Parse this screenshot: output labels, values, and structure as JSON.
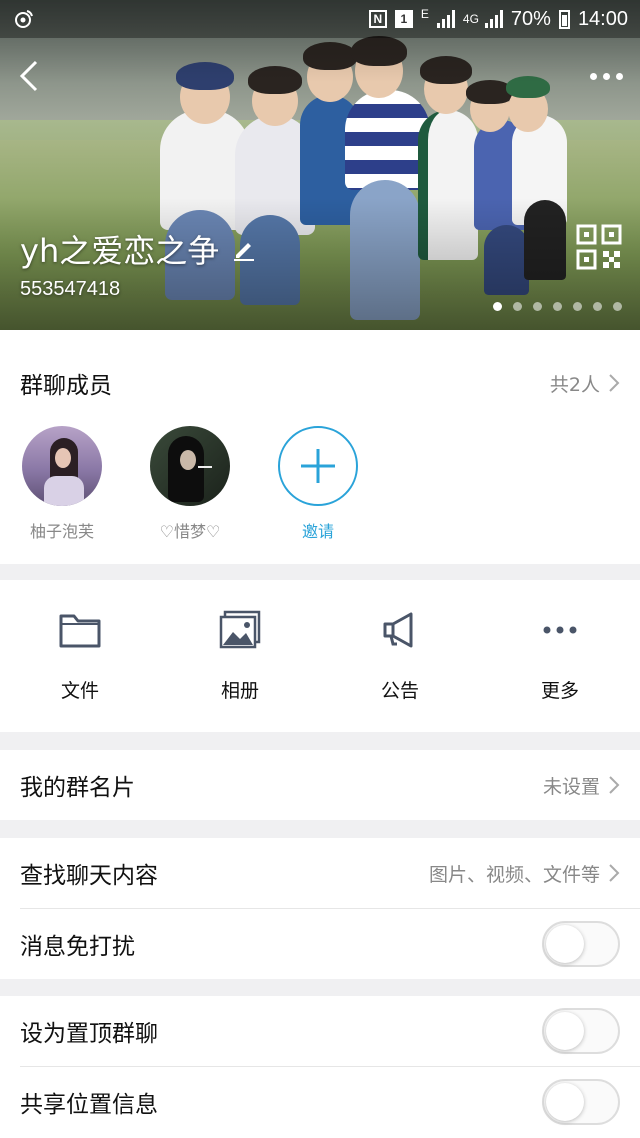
{
  "status_bar": {
    "time": "14:00",
    "battery": "70%",
    "network": "4G",
    "e_label": "E",
    "sim": "1",
    "nfc": "N"
  },
  "header": {
    "group_name": "yh之爱恋之争",
    "group_id": "553547418",
    "carousel_pages": 7,
    "carousel_active": 0
  },
  "members": {
    "title": "群聊成员",
    "count_text": "共2人",
    "list": [
      {
        "name": "柚子泡芙"
      },
      {
        "name": "♡惜梦♡"
      }
    ],
    "invite_label": "邀请"
  },
  "tools": [
    {
      "label": "文件",
      "icon": "folder-icon"
    },
    {
      "label": "相册",
      "icon": "album-icon"
    },
    {
      "label": "公告",
      "icon": "megaphone-icon"
    },
    {
      "label": "更多",
      "icon": "more-dots-icon"
    }
  ],
  "group_card": {
    "label": "我的群名片",
    "value": "未设置"
  },
  "search": {
    "label": "查找聊天内容",
    "hint": "图片、视频、文件等"
  },
  "settings": {
    "mute": {
      "label": "消息免打扰",
      "on": false
    },
    "pin": {
      "label": "设为置顶群聊",
      "on": false
    },
    "location": {
      "label": "共享位置信息",
      "on": false
    }
  },
  "colors": {
    "accent": "#2aa3d9",
    "background": "#f0f0f2"
  }
}
